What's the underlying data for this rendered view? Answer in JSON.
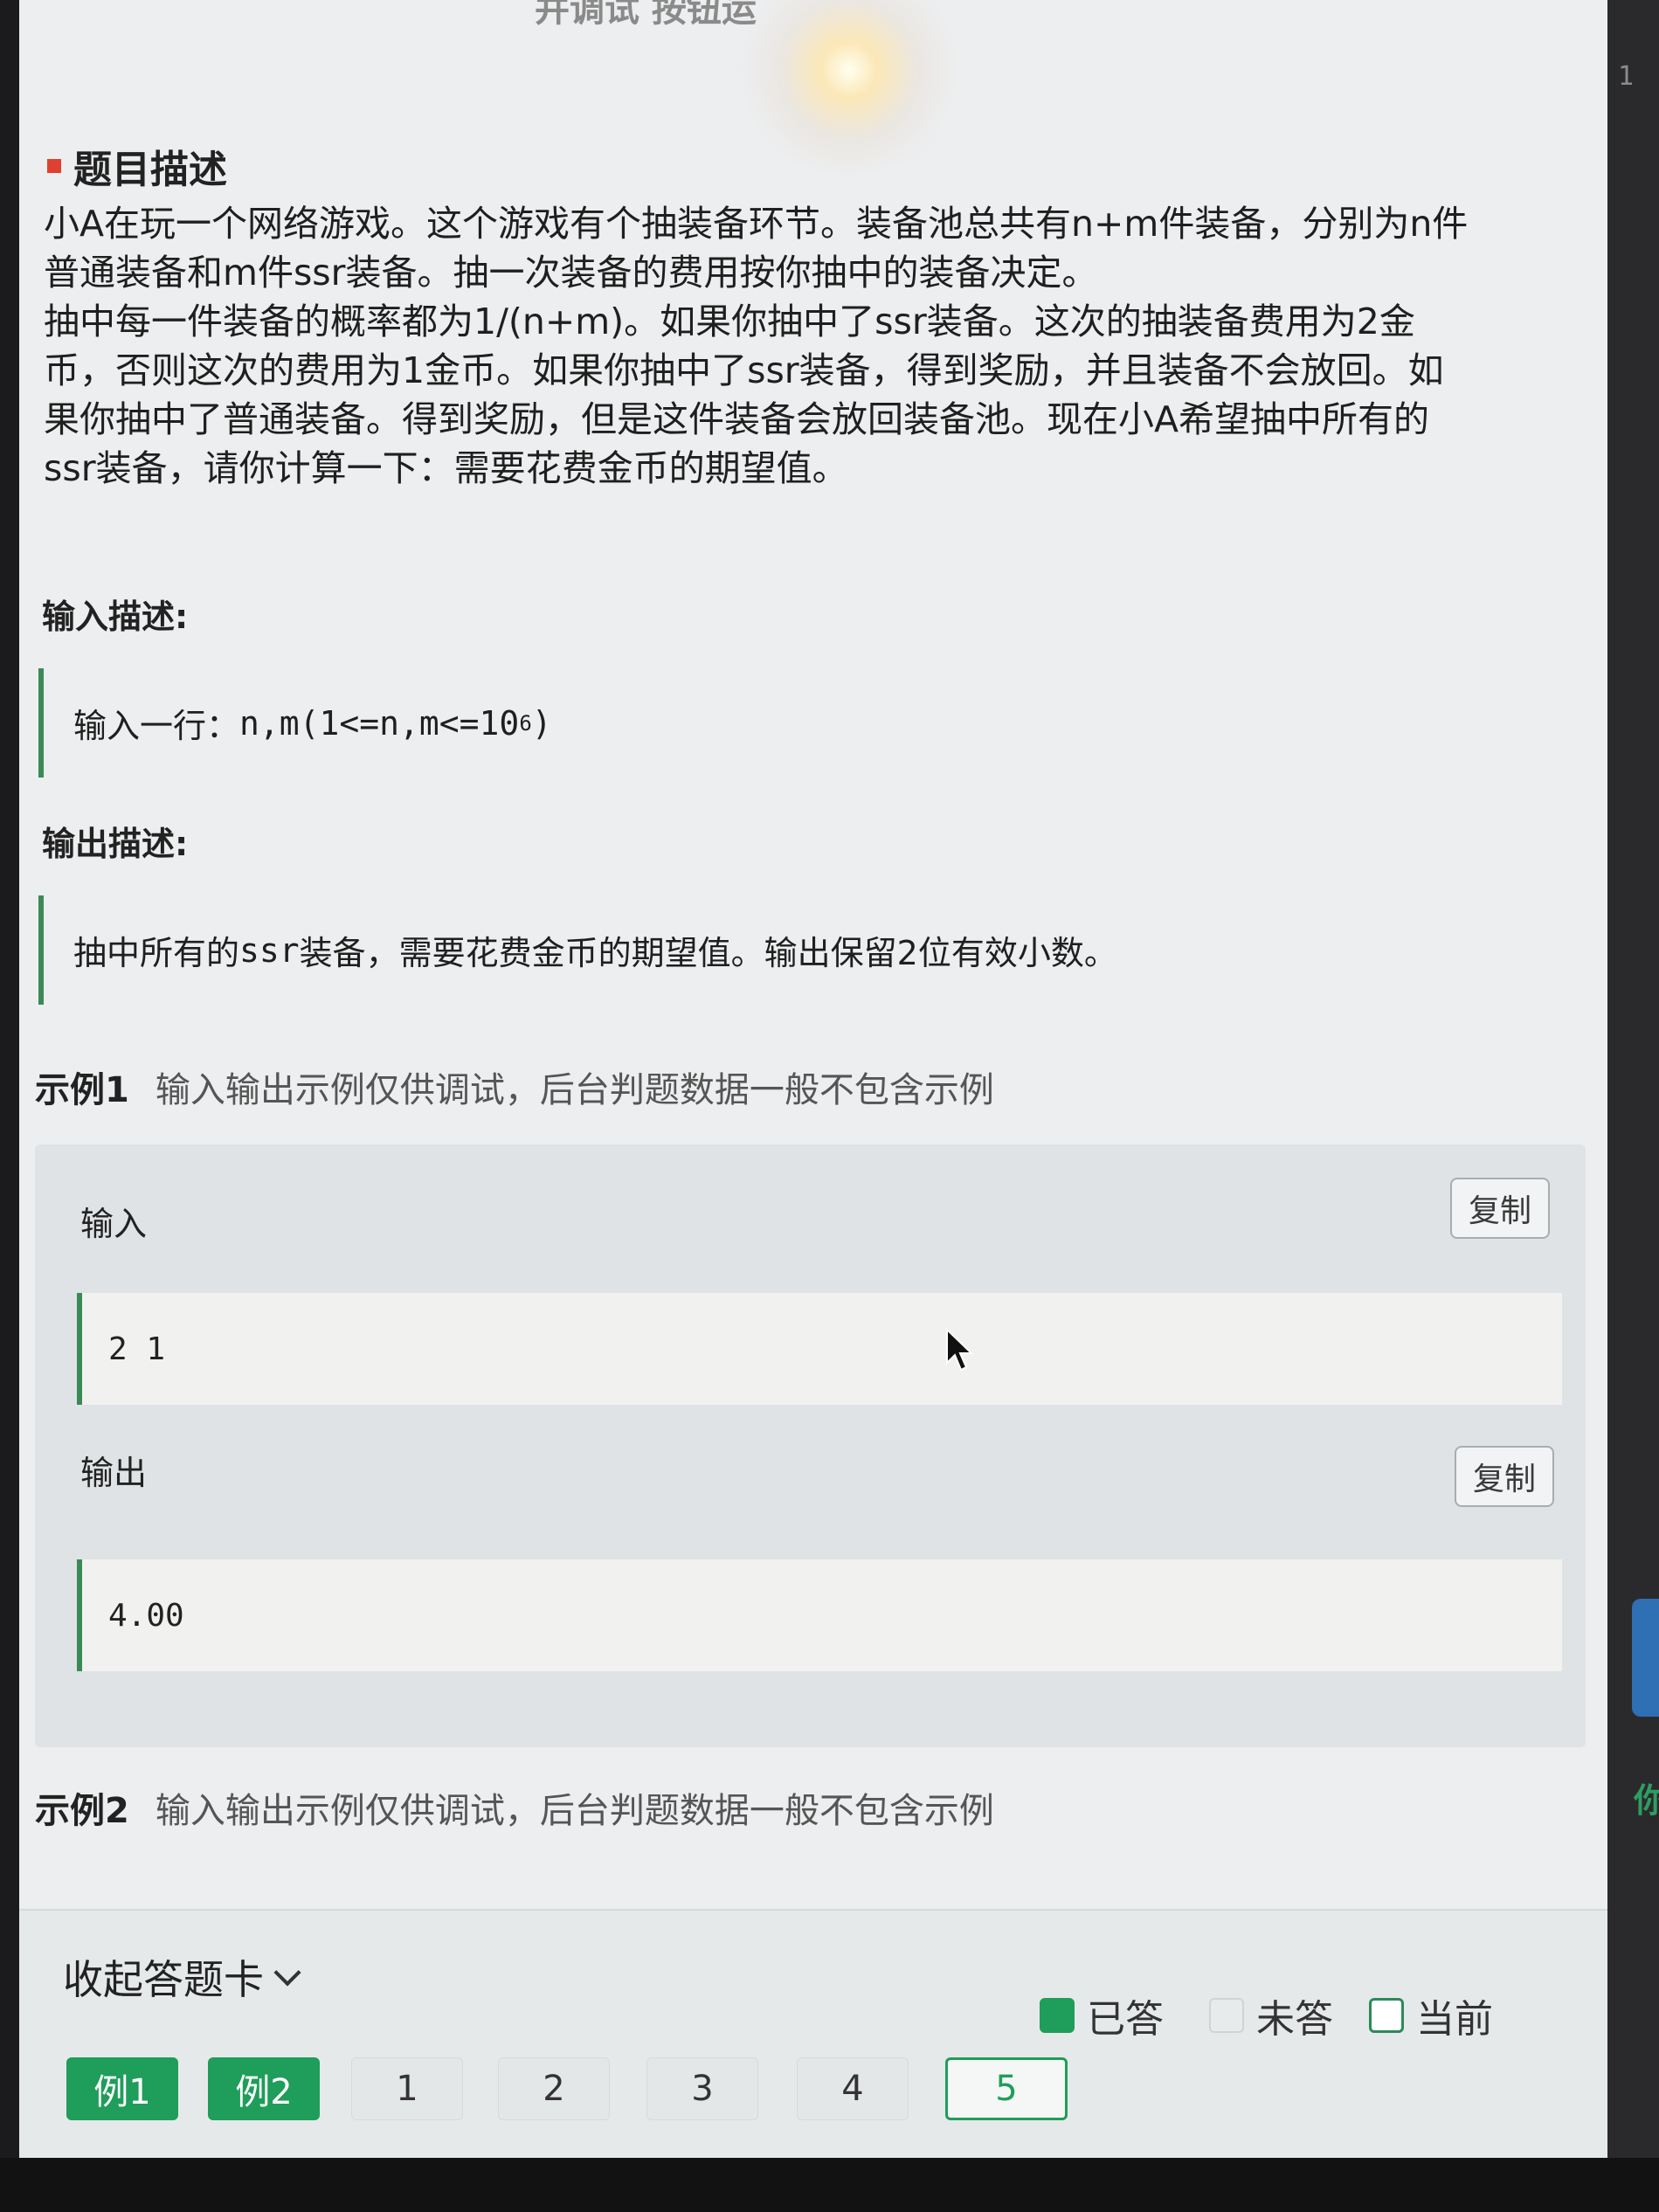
{
  "top_cut_text": "并调试 按钮运",
  "side_number": "1",
  "side_char": "你",
  "section_title": "题目描述",
  "problem_lines": [
    "小A在玩一个网络游戏。这个游戏有个抽装备环节。装备池总共有n+m件装备，分别为n件",
    "普通装备和m件ssr装备。抽一次装备的费用按你抽中的装备决定。",
    "抽中每一件装备的概率都为1/(n+m)。如果你抽中了ssr装备。这次的抽装备费用为2金",
    "币，否则这次的费用为1金币。如果你抽中了ssr装备，得到奖励，并且装备不会放回。如",
    "果你抽中了普通装备。得到奖励，但是这件装备会放回装备池。现在小A希望抽中所有的",
    "ssr装备，请你计算一下：需要花费金币的期望值。"
  ],
  "input_desc": {
    "label": "输入描述:",
    "prefix": "输入一行：",
    "code": "n,m(1<=n,m<=10",
    "sup": "6",
    "suffix": ")"
  },
  "output_desc": {
    "label": "输出描述:",
    "text_a": "抽中所有的",
    "text_code": "ssr",
    "text_b": "装备，需要花费金币的期望值。输出保留2位有效小数。"
  },
  "examples": [
    {
      "title": "示例1",
      "note": "输入输出示例仅供调试，后台判题数据一般不包含示例",
      "input_label": "输入",
      "input_value": "2 1",
      "output_label": "输出",
      "output_value": "4.00",
      "copy_label": "复制"
    },
    {
      "title": "示例2",
      "note": "输入输出示例仅供调试，后台判题数据一般不包含示例"
    }
  ],
  "answer_card": {
    "collapse_label": "收起答题卡",
    "legend": {
      "answered": "已答",
      "unanswered": "未答",
      "current": "当前"
    },
    "buttons": [
      "例1",
      "例2",
      "1",
      "2",
      "3",
      "4",
      "5"
    ],
    "current": "5"
  },
  "colors": {
    "accent": "#1f9d5a",
    "quote_border": "#3a8a55",
    "title_marker": "#e04030"
  }
}
